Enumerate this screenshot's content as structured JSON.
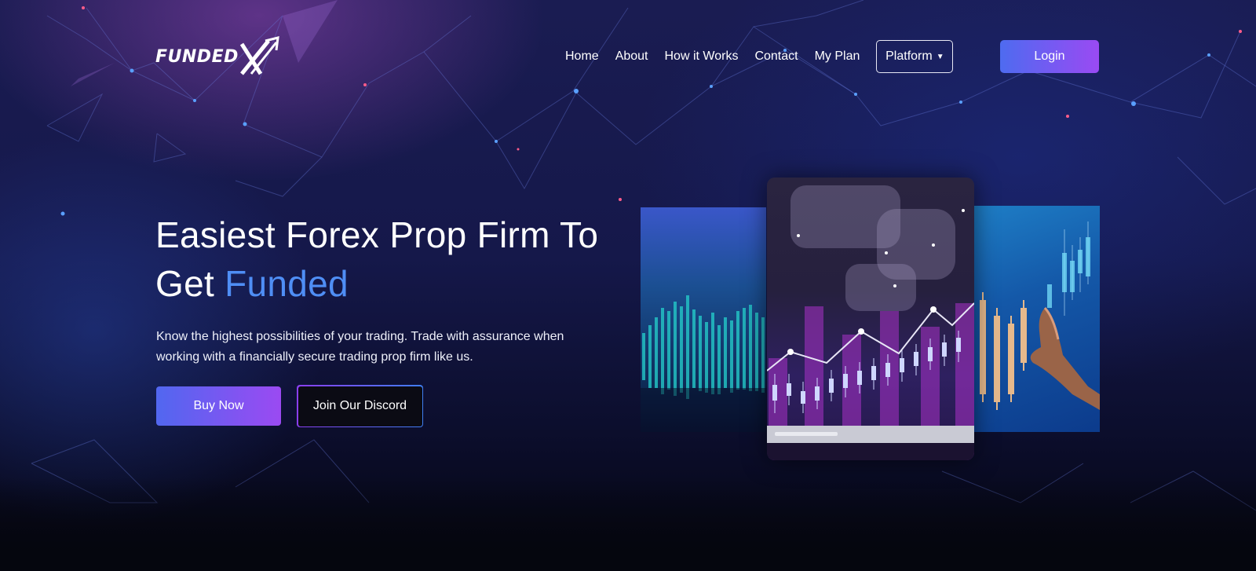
{
  "brand": {
    "logo_text": "FUNDED",
    "logo_icon": "x-arrow-logo-icon"
  },
  "nav": {
    "links": [
      "Home",
      "About",
      "How it Works",
      "Contact",
      "My Plan"
    ],
    "platform_label": "Platform",
    "login_label": "Login"
  },
  "hero": {
    "title_line1": "Easiest Forex Prop Firm To",
    "title_line2_prefix": "Get ",
    "title_line2_accent": "Funded",
    "subtitle": "Know the highest possibilities of your trading. Trade with assurance when working with a financially secure trading prop firm like us.",
    "buy_label": "Buy Now",
    "discord_label": "Join Our Discord"
  },
  "colors": {
    "accent_blue": "#4f8ef5",
    "gradient_start": "#5167f0",
    "gradient_end": "#9b4af2"
  }
}
